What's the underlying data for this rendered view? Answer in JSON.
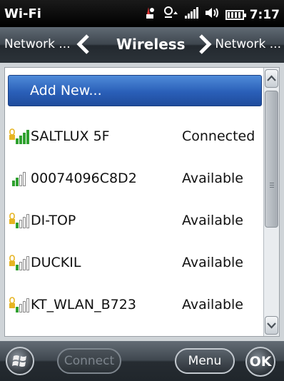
{
  "statusbar": {
    "title": "Wi-Fi",
    "clock": "7:17",
    "icons": [
      "notification-icon",
      "sync-icon",
      "signal-icon",
      "volume-icon",
      "battery-icon"
    ]
  },
  "nav": {
    "prev_label": "Network ...",
    "current_label": "Wireless",
    "next_label": "Network ..."
  },
  "list": {
    "add_new_label": "Add New...",
    "networks": [
      {
        "name": "SALTLUX 5F",
        "status": "Connected",
        "signal_bars": 4,
        "secured": true
      },
      {
        "name": "00074096C8D2",
        "status": "Available",
        "signal_bars": 2,
        "secured": false
      },
      {
        "name": "DI-TOP",
        "status": "Available",
        "signal_bars": 1,
        "secured": true
      },
      {
        "name": "DUCKIL",
        "status": "Available",
        "signal_bars": 1,
        "secured": true
      },
      {
        "name": "KT_WLAN_B723",
        "status": "Available",
        "signal_bars": 1,
        "secured": true
      }
    ]
  },
  "bottombar": {
    "connect_label": "Connect",
    "menu_label": "Menu",
    "ok_label": "OK"
  },
  "colors": {
    "accent": "#2a5fb8",
    "signal_green": "#2fa12f",
    "lock_yellow": "#e6b422"
  }
}
